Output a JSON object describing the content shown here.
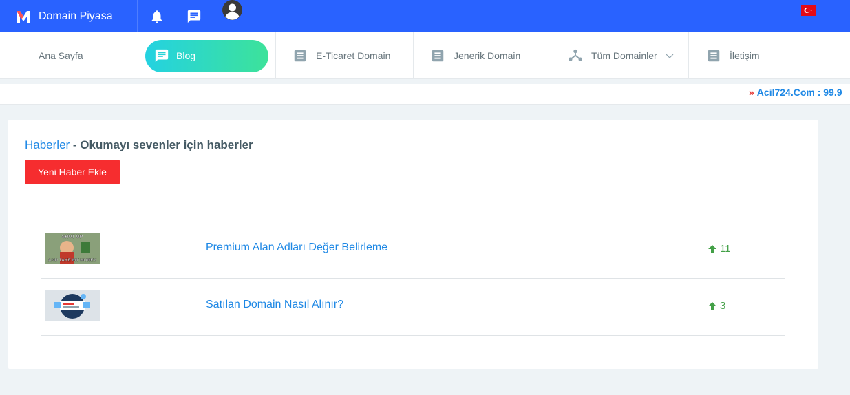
{
  "header": {
    "brand_name": "Domain Piyasa",
    "brand_color": "#2962ff",
    "icons": [
      "bell-icon",
      "message-icon",
      "user-avatar-icon",
      "turkey-flag-icon"
    ]
  },
  "nav": {
    "items": [
      {
        "label": "Ana Sayfa",
        "icon": ""
      },
      {
        "label": "Blog",
        "icon": "message-icon",
        "active": true
      },
      {
        "label": "E-Ticaret Domain",
        "icon": "document-icon"
      },
      {
        "label": "Jenerik Domain",
        "icon": "document-icon"
      },
      {
        "label": "Tüm Domainler",
        "icon": "network-icon",
        "dropdown": true
      },
      {
        "label": "İletişim",
        "icon": "document-icon"
      }
    ]
  },
  "ticker": {
    "text": "Acil724.Com : 99.9"
  },
  "card": {
    "title_accent": "Haberler",
    "title_rest": " - Okumayı sevenler için haberler",
    "add_button": "Yeni Haber Ekle",
    "news": [
      {
        "title": "Premium Alan Adları Değer Belirleme",
        "score": "11",
        "thumb_top": "SHUT UP",
        "thumb_bottom": "AND TAKE MY MONEY"
      },
      {
        "title": "Satılan Domain Nasıl Alınır?",
        "score": "3"
      }
    ]
  }
}
